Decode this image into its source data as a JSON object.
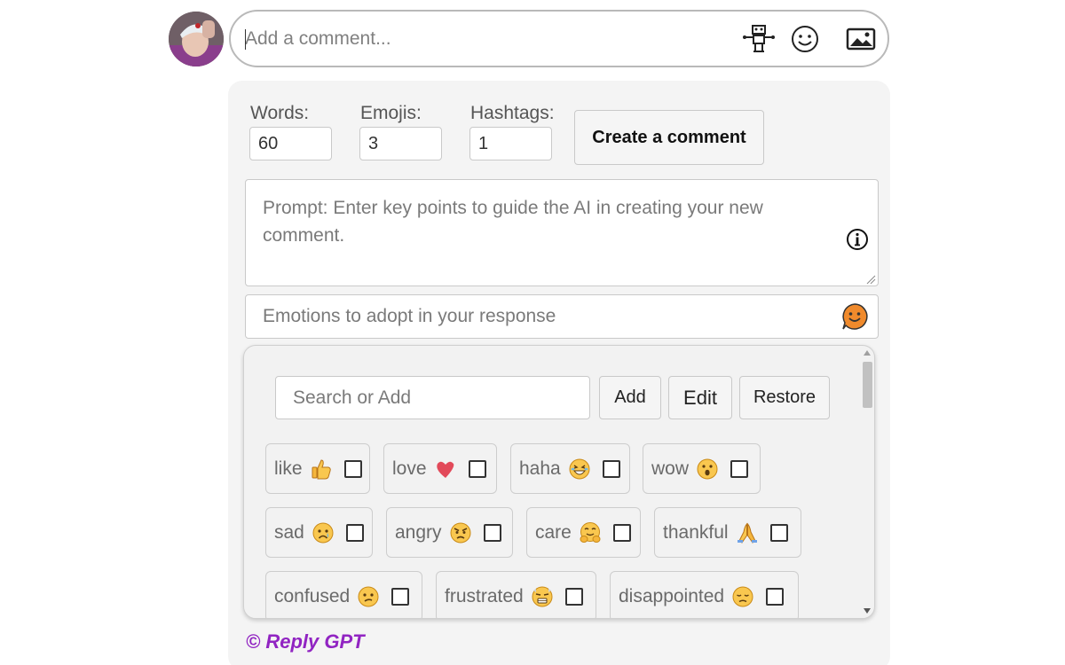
{
  "comment_bar": {
    "placeholder": "Add a comment...",
    "icons": [
      "robot-icon",
      "smiley-icon",
      "image-icon"
    ]
  },
  "controls": {
    "words_label": "Words:",
    "words_value": "60",
    "emojis_label": "Emojis:",
    "emojis_value": "3",
    "hashtags_label": "Hashtags:",
    "hashtags_value": "1",
    "create_label": "Create a comment"
  },
  "prompt": {
    "placeholder": "Prompt: Enter key points to guide the AI in creating your new comment."
  },
  "emotions": {
    "placeholder": "Emotions to adopt in your response",
    "search_placeholder": "Search or Add",
    "add_label": "Add",
    "edit_label": "Edit",
    "restore_label": "Restore",
    "items": [
      {
        "label": "like",
        "icon": "thumbs-up-icon",
        "checked": false
      },
      {
        "label": "love",
        "icon": "heart-icon",
        "checked": false
      },
      {
        "label": "haha",
        "icon": "laughing-icon",
        "checked": false
      },
      {
        "label": "wow",
        "icon": "wow-icon",
        "checked": false
      },
      {
        "label": "sad",
        "icon": "sad-icon",
        "checked": false
      },
      {
        "label": "angry",
        "icon": "angry-icon",
        "checked": false
      },
      {
        "label": "care",
        "icon": "care-icon",
        "checked": false
      },
      {
        "label": "thankful",
        "icon": "praying-hands-icon",
        "checked": false
      },
      {
        "label": "confused",
        "icon": "confused-icon",
        "checked": false
      },
      {
        "label": "frustrated",
        "icon": "frustrated-icon",
        "checked": false
      },
      {
        "label": "disappointed",
        "icon": "disappointed-icon",
        "checked": false
      }
    ]
  },
  "footer": {
    "brand": "© Reply GPT"
  },
  "colors": {
    "brand": "#9124c2",
    "panel_bg": "#f4f4f4",
    "emoji_orange": "#f08a2c"
  }
}
